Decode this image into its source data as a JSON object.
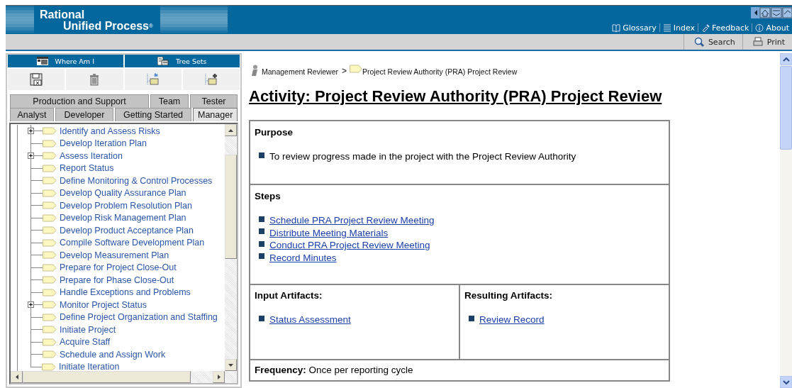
{
  "header": {
    "logo_line_1": "Rational",
    "logo_line_2": "Unified Process",
    "logo_mark": "®",
    "links": [
      {
        "label": "Glossary",
        "kind": "book"
      },
      {
        "label": "Index",
        "kind": "list"
      },
      {
        "label": "Feedback",
        "kind": "feedback"
      },
      {
        "label": "About",
        "kind": "info"
      }
    ]
  },
  "toolbar": {
    "buttons": [
      {
        "label": "Search",
        "kind": "search"
      },
      {
        "label": "Print",
        "kind": "print"
      }
    ]
  },
  "sidebar": {
    "view_buttons": [
      {
        "label": "Where Am I",
        "kind": "where"
      },
      {
        "label": "Tree Sets",
        "kind": "treesets"
      }
    ],
    "tab_rows": [
      [
        {
          "label": "Production and Support",
          "selected": false
        },
        {
          "label": "Team",
          "selected": false
        },
        {
          "label": "Tester",
          "selected": false
        }
      ],
      [
        {
          "label": "Analyst",
          "selected": false
        },
        {
          "label": "Developer",
          "selected": false
        },
        {
          "label": "Getting Started",
          "selected": false
        },
        {
          "label": "Manager",
          "selected": true
        }
      ]
    ],
    "tree": [
      {
        "label": "Identify and Assess Risks",
        "kind": "parent",
        "expanded": false
      },
      {
        "label": "Develop Iteration Plan"
      },
      {
        "label": "Assess Iteration",
        "kind": "parent",
        "expanded": false
      },
      {
        "label": "Report Status"
      },
      {
        "label": "Define Monitoring & Control Processes"
      },
      {
        "label": "Develop Quality Assurance Plan"
      },
      {
        "label": "Develop Problem Resolution Plan"
      },
      {
        "label": "Develop Risk Management Plan"
      },
      {
        "label": "Develop Product Acceptance Plan"
      },
      {
        "label": "Compile Software Development Plan"
      },
      {
        "label": "Develop Measurement Plan"
      },
      {
        "label": "Prepare for Project Close-Out"
      },
      {
        "label": "Prepare for Phase Close-Out"
      },
      {
        "label": "Handle Exceptions and Problems"
      },
      {
        "label": "Monitor Project Status",
        "kind": "parent",
        "expanded": false
      },
      {
        "label": "Define Project Organization and Staffing"
      },
      {
        "label": "Initiate Project"
      },
      {
        "label": "Acquire Staff"
      },
      {
        "label": "Schedule and Assign Work"
      },
      {
        "label": "Initiate Iteration"
      }
    ]
  },
  "content": {
    "breadcrumb": [
      {
        "label": "Management Reviewer",
        "kind": "role"
      },
      {
        "label": "Project Review Authority (PRA) Project Review",
        "kind": "activity"
      }
    ],
    "breadcrumb_separator": ">",
    "title": "Activity: Project Review Authority (PRA) Project Review",
    "sections": [
      {
        "kind": "text-list",
        "heading": "Purpose",
        "items": [
          "To review progress made in the project with the Project Review Authority"
        ]
      },
      {
        "kind": "link-list",
        "heading": "Steps",
        "items": [
          "Schedule PRA Project Review Meeting",
          "Distribute Meeting Materials",
          "Conduct PRA Project Review Meeting",
          "Record Minutes"
        ]
      },
      {
        "kind": "columns",
        "columns": [
          {
            "heading": "Input Artifacts:",
            "items": [
              "Status Assessment"
            ]
          },
          {
            "heading": "Resulting Artifacts:",
            "items": [
              "Review Record"
            ]
          }
        ]
      },
      {
        "kind": "inline",
        "heading": "Frequency:",
        "text": "Once per reporting cycle"
      }
    ]
  }
}
